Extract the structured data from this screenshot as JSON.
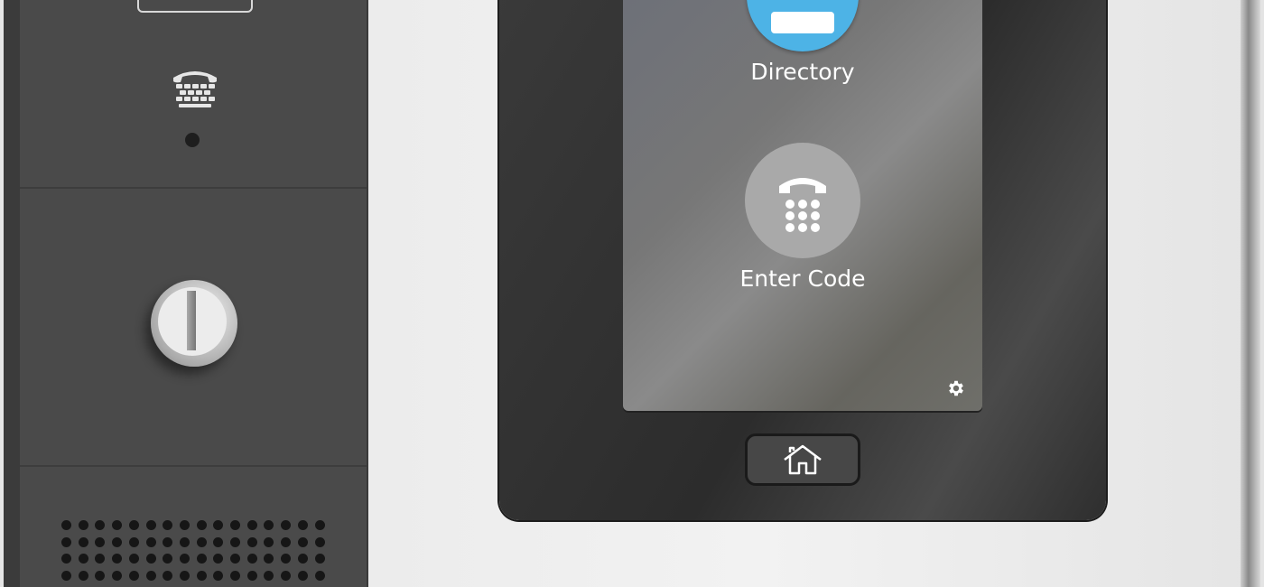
{
  "colors": {
    "directory_accent": "#4db3e6",
    "code_button": "#a9a9a9",
    "panel": "#4a4a4a",
    "bezel": "#2e2e2e"
  },
  "screen": {
    "directory": {
      "label": "Directory",
      "icon": "directory-icon"
    },
    "enter_code": {
      "label": "Enter Code",
      "icon": "keypad-phone-icon"
    },
    "settings": {
      "icon": "gear-icon"
    }
  },
  "hardware": {
    "home_button": {
      "icon": "home-icon"
    },
    "tty_icon": "tty-icon",
    "lock": "key-lock-icon",
    "speaker": "speaker-grille"
  }
}
